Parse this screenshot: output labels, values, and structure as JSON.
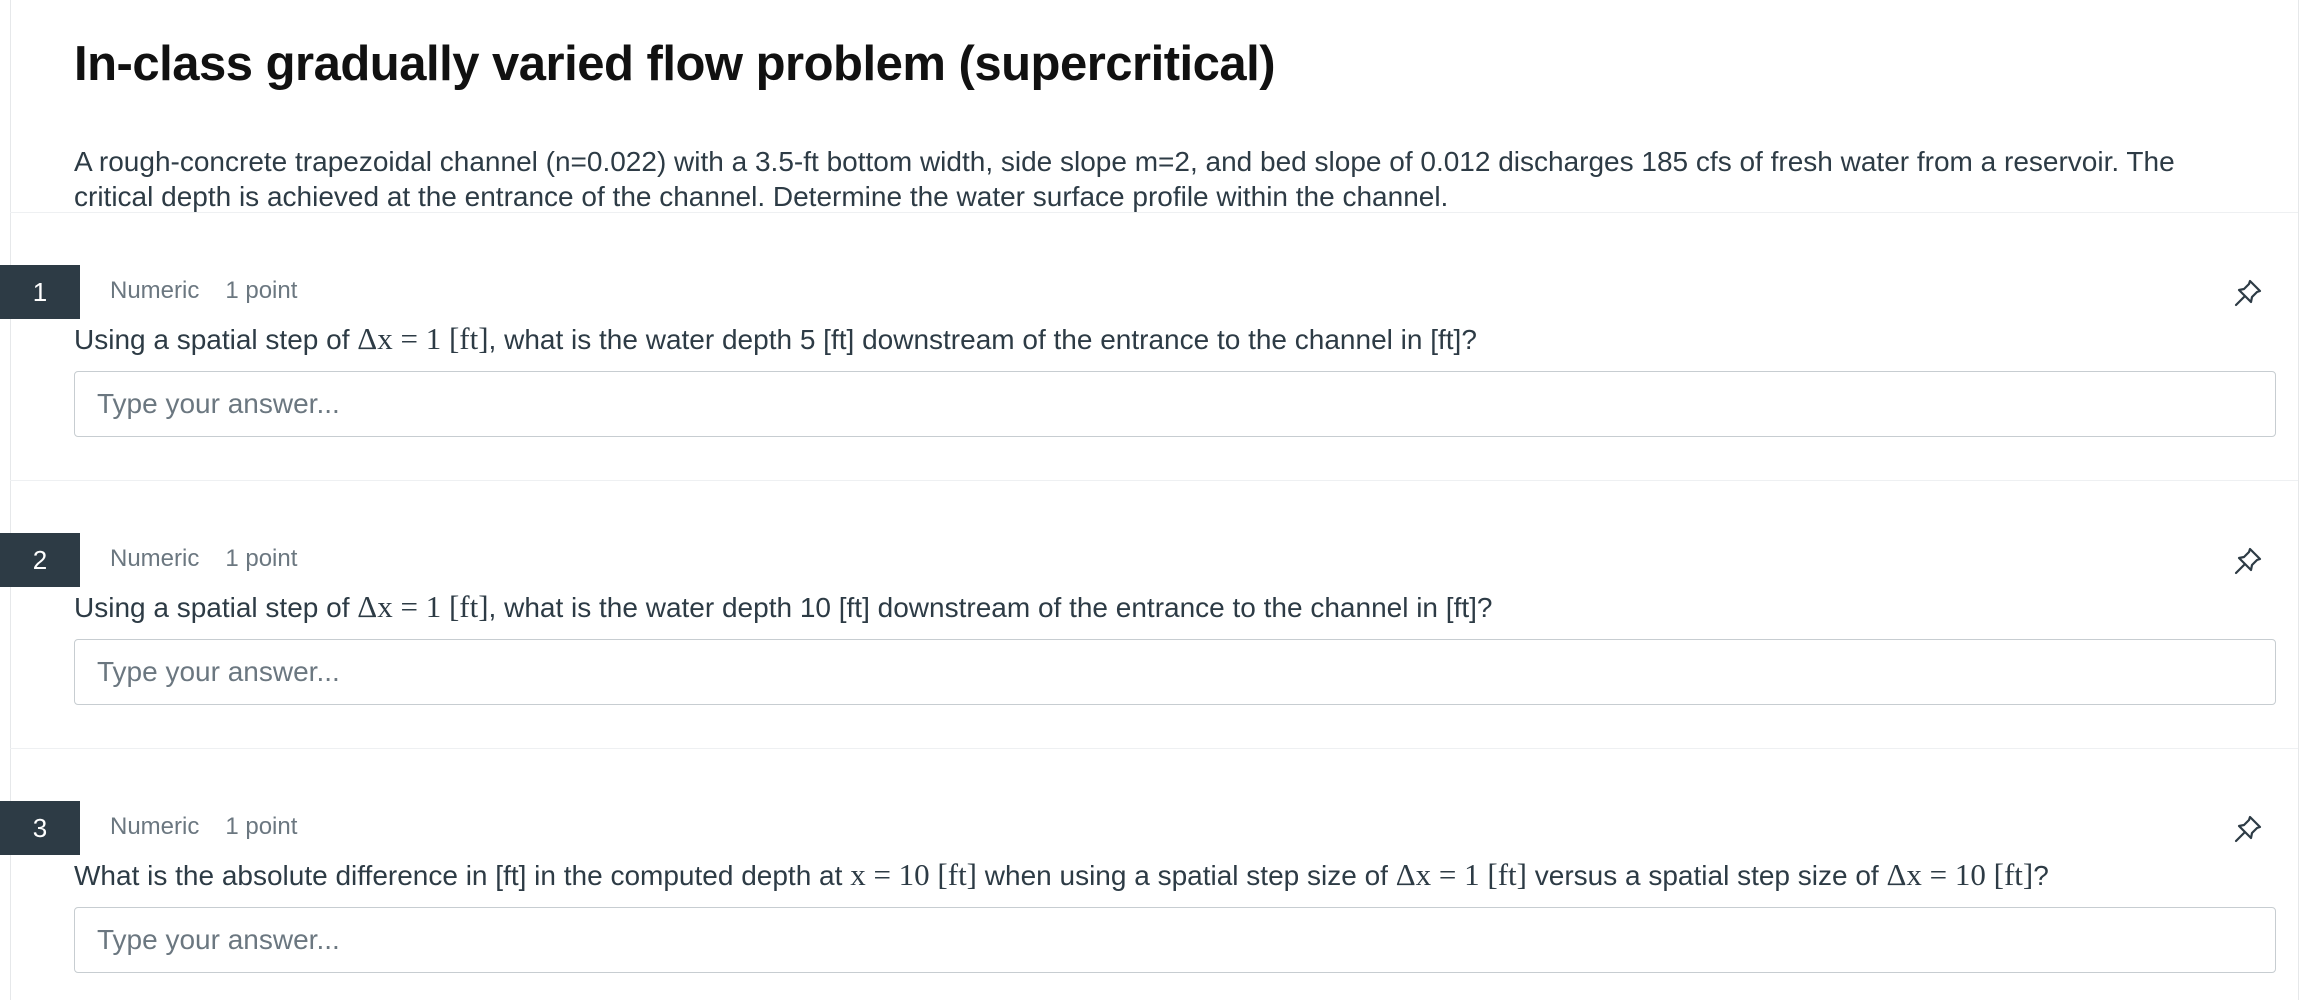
{
  "page": {
    "title": "In-class gradually varied flow problem (supercritical)",
    "intro": "A rough-concrete trapezoidal channel (n=0.022) with a 3.5-ft bottom width, side slope m=2, and bed slope of 0.012 discharges 185 cfs of fresh water from a reservoir. The critical depth is achieved at the entrance of the channel. Determine the water surface profile within the channel."
  },
  "questions": [
    {
      "number": "1",
      "type": "Numeric",
      "points": "1 point",
      "text_a": "Using a spatial step of ",
      "math_a": "Δx = 1 [ft]",
      "text_b": ", what is the water depth 5 [ft] downstream of the entrance to the channel in [ft]?",
      "placeholder": "Type your answer..."
    },
    {
      "number": "2",
      "type": "Numeric",
      "points": "1 point",
      "text_a": "Using a spatial step of ",
      "math_a": "Δx = 1 [ft]",
      "text_b": ", what is the water depth 10 [ft] downstream of the entrance to the channel in [ft]?",
      "placeholder": "Type your answer..."
    },
    {
      "number": "3",
      "type": "Numeric",
      "points": "1 point",
      "text_a": "What is the absolute difference in [ft] in the computed depth at ",
      "math_a": "x = 10 [ft]",
      "text_b": " when using a spatial step size of ",
      "math_b": "Δx = 1 [ft]",
      "text_c": " versus a spatial step size of ",
      "math_c": "Δx = 10 [ft]",
      "text_d": "?",
      "placeholder": "Type your answer..."
    }
  ],
  "icons": {
    "pin": "pin-icon"
  },
  "colors": {
    "number_badge": "#2d3b45",
    "text": "#2d3b45",
    "meta": "#6b7780",
    "border": "#c7cdd1"
  }
}
